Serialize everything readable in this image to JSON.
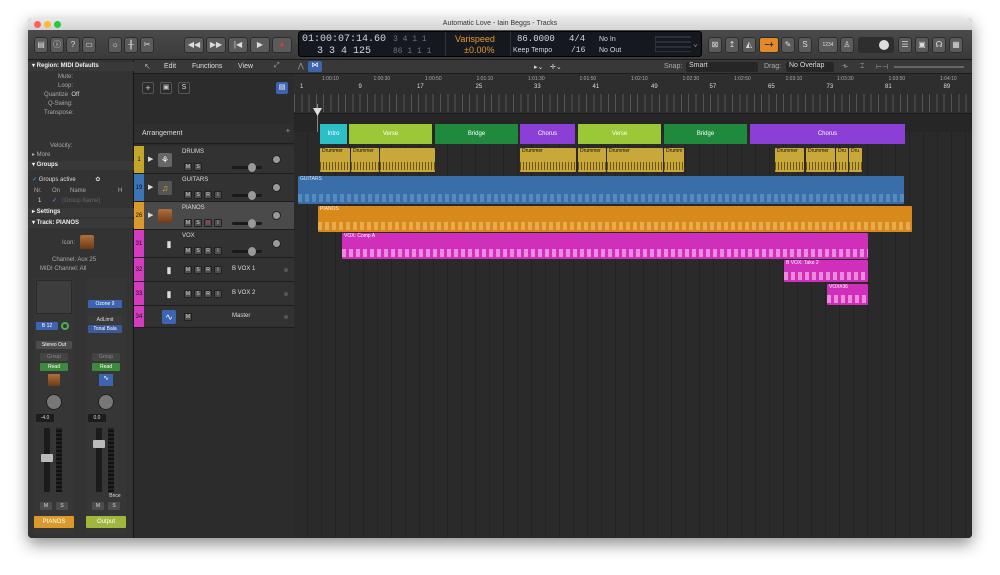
{
  "window": {
    "title": "Automatic Love - Iain Beggs - Tracks",
    "traffic_colors": [
      "#ff5f57",
      "#febc2e",
      "#28c840"
    ]
  },
  "lcd": {
    "time": "01:00:07:14.60",
    "bars": "3 3 4 125",
    "bars_dim_a": "3 4 1 1",
    "bars_dim_b": "86 1 1 1",
    "varispeed_label": "Varispeed",
    "varispeed_value": "±0.00%",
    "tempo": "86.0000",
    "tempo_mode": "Keep Tempo",
    "sig_top": "4/4",
    "sig_bottom": "/16",
    "in_label": "No In",
    "out_label": "No Out"
  },
  "arrange_toolbar": {
    "edit": "Edit",
    "functions": "Functions",
    "view": "View",
    "snap_label": "Snap:",
    "snap_value": "Smart",
    "drag_label": "Drag:",
    "drag_value": "No Overlap"
  },
  "inspector": {
    "region_header": "▾ Region: MIDI Defaults",
    "rows": [
      {
        "label": "Mute:",
        "value": ""
      },
      {
        "label": "Loop:",
        "value": ""
      },
      {
        "label": "Quantize",
        "value": "Off"
      },
      {
        "label": "Q-Swing:",
        "value": ""
      },
      {
        "label": "Transpose:",
        "value": ""
      },
      {
        "label": "Velocity:",
        "value": ""
      }
    ],
    "more": "▸ More",
    "groups": "▾ Groups",
    "groups_active": "Groups active",
    "groups_cols": [
      "Nr.",
      "On",
      "Name",
      "H"
    ],
    "group_row_nr": "1",
    "group_row_name": "(Group Name)",
    "settings": "▸ Settings",
    "track_header": "▾ Track:  PIANOS",
    "icon_label": "Icon:",
    "channel": "Channel:  Aux 25",
    "midi_channel": "MIDI Channel:  All"
  },
  "strips": {
    "left": {
      "plugin": "",
      "bus": "B 12",
      "output": "Stereo Out",
      "group": "Group",
      "automation": "Read",
      "volume": "-4.0",
      "name": "PIANOS",
      "color": "#d99a2b"
    },
    "right": {
      "plugin_1": "Ozone 9",
      "plugin_2": "AdLimit",
      "plugin_3": "Tonal Bala",
      "group": "Group",
      "automation": "Read",
      "volume": "0.0",
      "bounce": "Bnce",
      "name": "Output",
      "color": "#a1b63c"
    },
    "mute": "M",
    "solo": "S"
  },
  "tracklist": {
    "add_button": "+",
    "arrangement_label": "Arrangement",
    "tracks": [
      {
        "num": "1",
        "name": "DRUMS",
        "color": "#c6a52c"
      },
      {
        "num": "19",
        "name": "GUITARS",
        "color": "#3a76b5"
      },
      {
        "num": "26",
        "name": "PIANOS",
        "color": "#d99a2b"
      },
      {
        "num": "31",
        "name": "VOX",
        "color": "#d43bc0"
      },
      {
        "num": "32",
        "name": "B VOX 1",
        "color": "#d43bc0"
      },
      {
        "num": "33",
        "name": "B VOX 2",
        "color": "#d43bc0"
      },
      {
        "num": "34",
        "name": "Master",
        "color": "#d43bc0"
      }
    ],
    "mute": "M",
    "solo": "S",
    "rec": "R",
    "input": "I"
  },
  "ruler": {
    "bars": [
      "1",
      "9",
      "17",
      "25",
      "33",
      "41",
      "49",
      "57",
      "65",
      "73",
      "81",
      "89"
    ],
    "times": [
      "1:00:10",
      "1:00:30",
      "1:00:50",
      "1:01:10",
      "1:01:30",
      "1:01:50",
      "1:02:10",
      "1:02:30",
      "1:02:50",
      "1:03:10",
      "1:03:30",
      "1:03:50",
      "1:04:10"
    ]
  },
  "arrangement": [
    {
      "label": "Intro",
      "color": "#2bbfc7"
    },
    {
      "label": "Verse",
      "color": "#9bc837"
    },
    {
      "label": "Bridge",
      "color": "#1f8a3e"
    },
    {
      "label": "Chorus",
      "color": "#8b3fd6"
    },
    {
      "label": "Verse",
      "color": "#9bc837"
    },
    {
      "label": "Bridge",
      "color": "#1f8a3e"
    },
    {
      "label": "Chorus",
      "color": "#8b3fd6"
    }
  ],
  "regions": {
    "drummer": "Drummer",
    "drummer_short": "Drumm",
    "dru": "Dru",
    "guitars": "GUITARS",
    "pianos": "PIANOS",
    "vox_comp": "VOX: Comp A",
    "bvox_take": "B VOX: Take 2",
    "vox36": "VOX#36"
  }
}
